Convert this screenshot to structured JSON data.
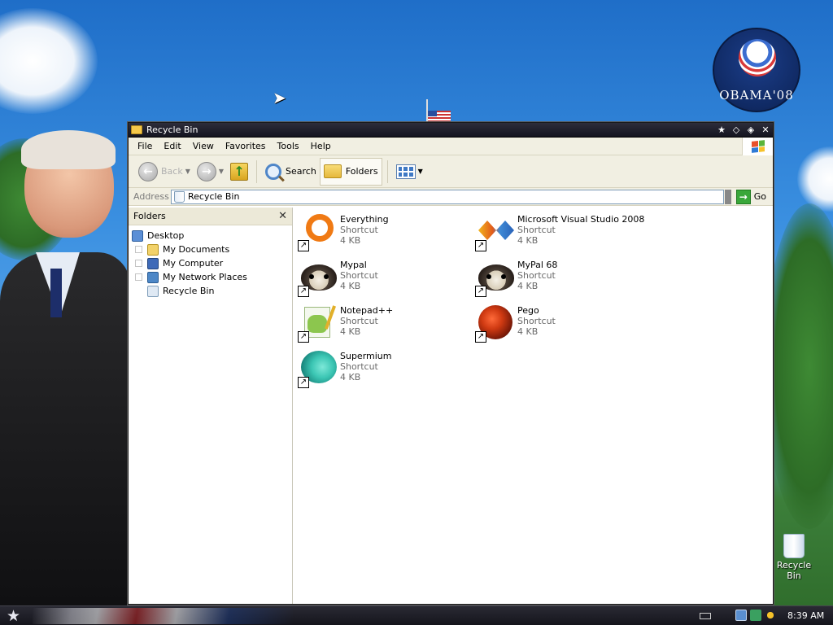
{
  "desktop": {
    "badge_text": "OBAMA'08",
    "recycle_bin_label": "Recycle Bin"
  },
  "window": {
    "title": "Recycle Bin",
    "menu": [
      "File",
      "Edit",
      "View",
      "Favorites",
      "Tools",
      "Help"
    ],
    "toolbar": {
      "back_label": "Back",
      "search_label": "Search",
      "folders_label": "Folders"
    },
    "address": {
      "label": "Address",
      "value": "Recycle Bin",
      "go_label": "Go"
    },
    "folders_pane": {
      "title": "Folders",
      "items": [
        {
          "label": "Desktop"
        },
        {
          "label": "My Documents"
        },
        {
          "label": "My Computer"
        },
        {
          "label": "My Network Places"
        },
        {
          "label": "Recycle Bin"
        }
      ]
    },
    "files": [
      {
        "name": "Everything",
        "type": "Shortcut",
        "size": "4 KB",
        "icon": "everything-icon"
      },
      {
        "name": "Microsoft Visual Studio 2008",
        "type": "Shortcut",
        "size": "4 KB",
        "icon": "visual-studio-icon"
      },
      {
        "name": "Mypal",
        "type": "Shortcut",
        "size": "4 KB",
        "icon": "mypal-icon"
      },
      {
        "name": "MyPal 68",
        "type": "Shortcut",
        "size": "4 KB",
        "icon": "mypal-icon"
      },
      {
        "name": "Notepad++",
        "type": "Shortcut",
        "size": "4 KB",
        "icon": "notepad-plus-plus-icon"
      },
      {
        "name": "Pego",
        "type": "Shortcut",
        "size": "4 KB",
        "icon": "pego-icon"
      },
      {
        "name": "Supermium",
        "type": "Shortcut",
        "size": "4 KB",
        "icon": "supermium-icon"
      }
    ]
  },
  "taskbar": {
    "clock": "8:39 AM"
  }
}
